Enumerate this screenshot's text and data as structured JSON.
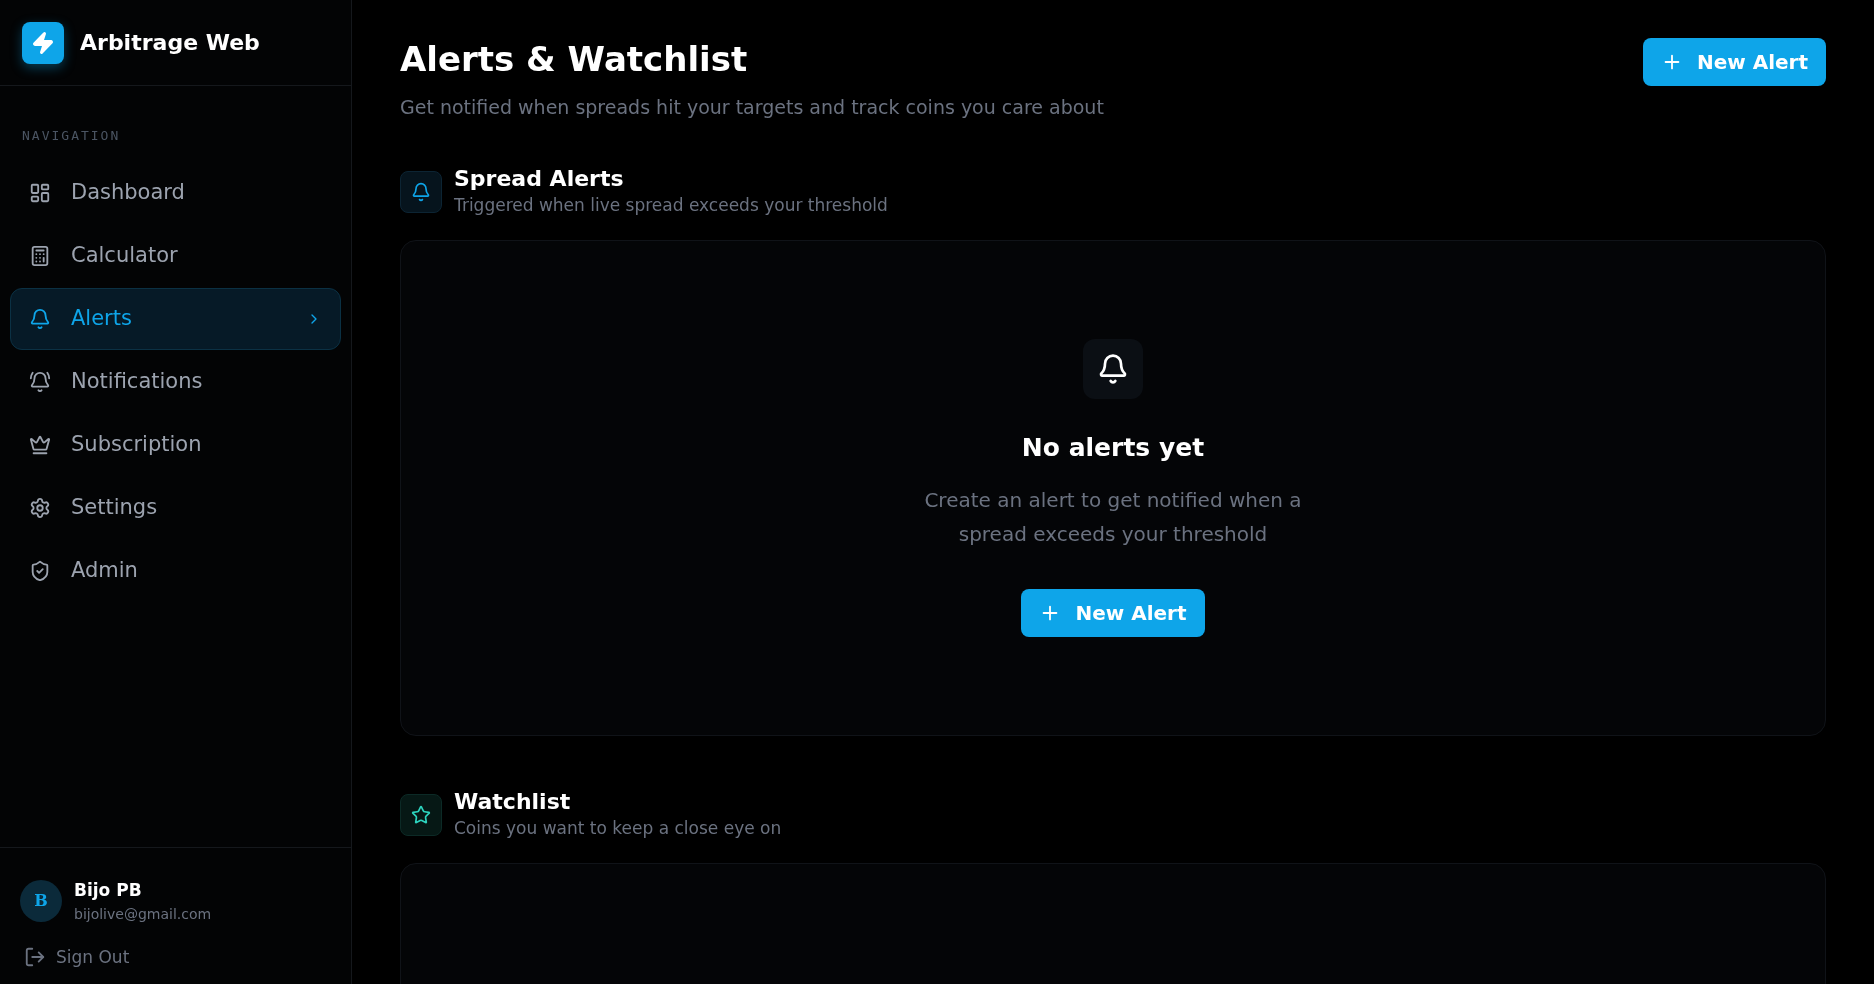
{
  "brand": {
    "name": "Arbitrage Web"
  },
  "sidebar": {
    "section_label": "NAVIGATION",
    "items": [
      {
        "label": "Dashboard",
        "selected": false
      },
      {
        "label": "Calculator",
        "selected": false
      },
      {
        "label": "Alerts",
        "selected": true
      },
      {
        "label": "Notifications",
        "selected": false
      },
      {
        "label": "Subscription",
        "selected": false
      },
      {
        "label": "Settings",
        "selected": false
      },
      {
        "label": "Admin",
        "selected": false
      }
    ]
  },
  "user": {
    "initial": "B",
    "name": "Bijo PB",
    "email": "bijolive@gmail.com"
  },
  "sign_out": "Sign Out",
  "header": {
    "title": "Alerts & Watchlist",
    "subtitle": "Get notified when spreads hit your targets and track coins you care about",
    "button": "New Alert"
  },
  "sections": [
    {
      "kind": "alerts",
      "title": "Spread Alerts",
      "subtitle": "Triggered when live spread exceeds your threshold",
      "empty": {
        "title": "No alerts yet",
        "text": "Create an alert to get notified when a spread exceeds your threshold",
        "button": "New Alert"
      }
    },
    {
      "kind": "watchlist",
      "title": "Watchlist",
      "subtitle": "Coins you want to keep a close eye on"
    }
  ]
}
